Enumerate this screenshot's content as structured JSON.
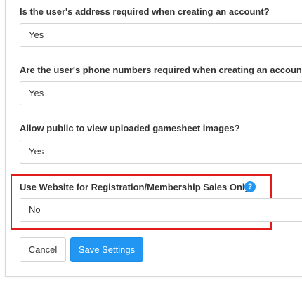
{
  "settings": [
    {
      "question": "Is the user's address required when creating an account?",
      "value": "Yes"
    },
    {
      "question": "Are the user's phone numbers required when creating an account?",
      "value": "Yes"
    },
    {
      "question": "Allow public to view uploaded gamesheet images?",
      "value": "Yes"
    },
    {
      "question": "Use Website for Registration/Membership Sales Only?",
      "value": "No"
    }
  ],
  "help_icon_glyph": "?",
  "buttons": {
    "cancel_label": "Cancel",
    "save_label": "Save Settings"
  },
  "colors": {
    "accent": "#2196f3",
    "highlight_border": "#e21b1b"
  },
  "icons": {
    "help": "question-circle-icon"
  }
}
